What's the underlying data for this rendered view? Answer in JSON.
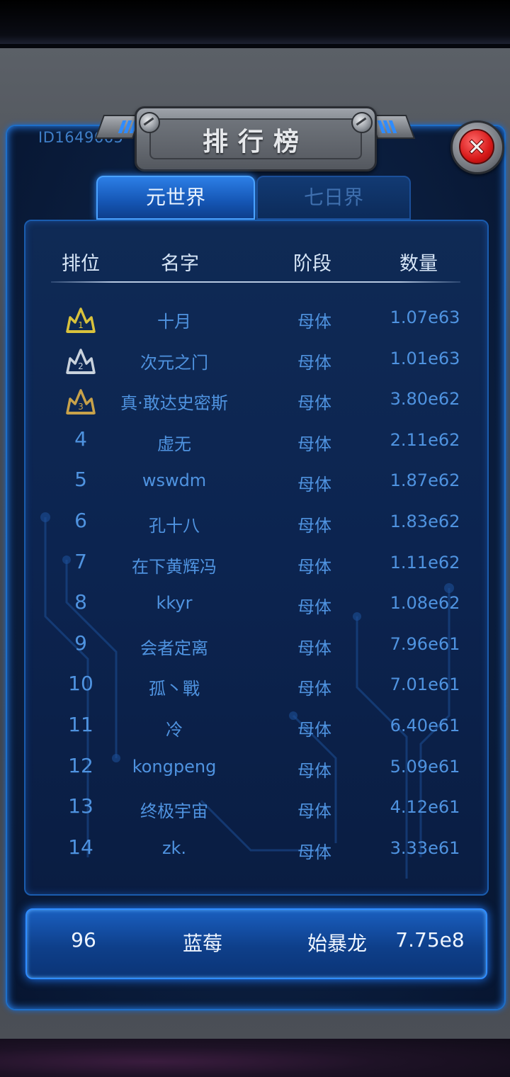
{
  "window": {
    "title": "排行榜",
    "user_id": "ID1649665"
  },
  "tabs": [
    {
      "label": "元世界",
      "active": true
    },
    {
      "label": "七日界",
      "active": false
    }
  ],
  "columns": [
    "排位",
    "名字",
    "阶段",
    "数量"
  ],
  "rows": [
    {
      "rank": "1",
      "name": "十月",
      "stage": "母体",
      "amount": "1.07e63",
      "medal": "gold"
    },
    {
      "rank": "2",
      "name": "次元之门",
      "stage": "母体",
      "amount": "1.01e63",
      "medal": "silver"
    },
    {
      "rank": "3",
      "name": "真·敢达史密斯",
      "stage": "母体",
      "amount": "3.80e62",
      "medal": "bronze"
    },
    {
      "rank": "4",
      "name": "虚无",
      "stage": "母体",
      "amount": "2.11e62"
    },
    {
      "rank": "5",
      "name": "wswdm",
      "stage": "母体",
      "amount": "1.87e62"
    },
    {
      "rank": "6",
      "name": "孔十八",
      "stage": "母体",
      "amount": "1.83e62"
    },
    {
      "rank": "7",
      "name": "在下黄辉冯",
      "stage": "母体",
      "amount": "1.11e62"
    },
    {
      "rank": "8",
      "name": "kkyr",
      "stage": "母体",
      "amount": "1.08e62"
    },
    {
      "rank": "9",
      "name": "会者定离",
      "stage": "母体",
      "amount": "7.96e61"
    },
    {
      "rank": "10",
      "name": "孤丶戰",
      "stage": "母体",
      "amount": "7.01e61"
    },
    {
      "rank": "11",
      "name": "冷",
      "stage": "母体",
      "amount": "6.40e61"
    },
    {
      "rank": "12",
      "name": "kongpeng",
      "stage": "母体",
      "amount": "5.09e61"
    },
    {
      "rank": "13",
      "name": "终极宇宙",
      "stage": "母体",
      "amount": "4.12e61"
    },
    {
      "rank": "14",
      "name": "zk.",
      "stage": "母体",
      "amount": "3.33e61"
    }
  ],
  "self": {
    "rank": "96",
    "name": "蓝莓",
    "stage": "始暴龙",
    "amount": "7.75e8"
  },
  "colors": {
    "gold": "#d9c23c",
    "silver": "#c9d2dc",
    "bronze": "#c8a24a",
    "accent": "#2f8cff",
    "close_red": "#d61818"
  },
  "icons": {
    "close": "close-icon",
    "medal": "crown-medal-icon"
  }
}
